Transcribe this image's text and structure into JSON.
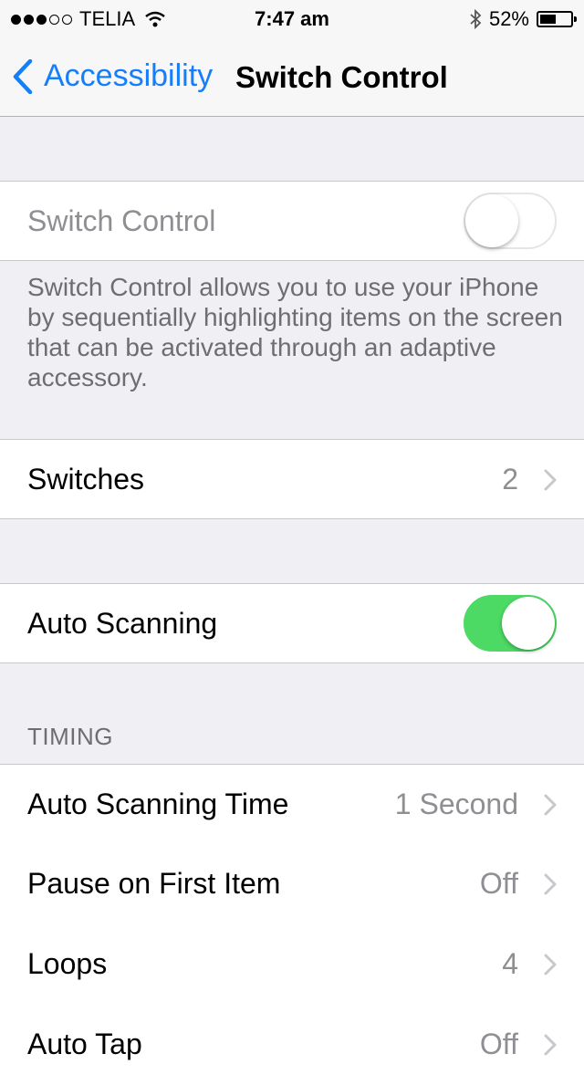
{
  "status_bar": {
    "carrier": "TELIA",
    "time": "7:47 am",
    "battery": "52%",
    "battery_level": 0.52
  },
  "nav": {
    "back_label": "Accessibility",
    "title": "Switch Control"
  },
  "switch_control": {
    "label": "Switch Control",
    "on": false,
    "description": "Switch Control allows you to use your iPhone by sequentially highlighting items on the screen that can be activated through an adaptive accessory."
  },
  "switches": {
    "label": "Switches",
    "value": "2"
  },
  "auto_scanning": {
    "label": "Auto Scanning",
    "on": true
  },
  "timing": {
    "header": "TIMING",
    "rows": [
      {
        "label": "Auto Scanning Time",
        "value": "1 Second"
      },
      {
        "label": "Pause on First Item",
        "value": "Off"
      },
      {
        "label": "Loops",
        "value": "4"
      },
      {
        "label": "Auto Tap",
        "value": "Off"
      }
    ]
  },
  "colors": {
    "accent": "#147efb",
    "toggle_on": "#4cd964",
    "background": "#efeff4"
  }
}
